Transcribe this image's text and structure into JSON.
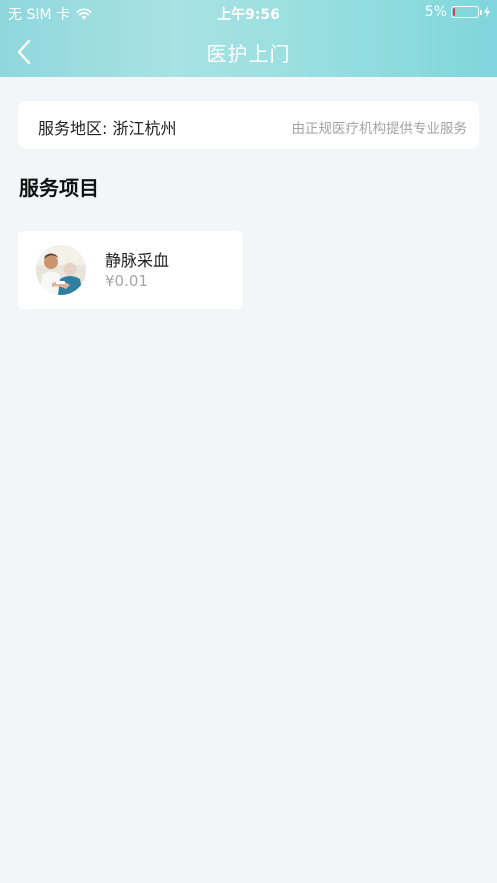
{
  "status_bar": {
    "carrier": "无 SIM 卡",
    "time": "上午9:56",
    "battery": "5%",
    "battery_level": 0.05,
    "icons": [
      "wifi-icon",
      "battery-icon",
      "charging-icon"
    ]
  },
  "nav": {
    "title": "医护上门",
    "back_icon": "chevron-left-icon"
  },
  "region": {
    "label": "服务地区: 浙江杭州",
    "note": "由正规医疗机构提供专业服务"
  },
  "section": {
    "title": "服务项目"
  },
  "services": [
    {
      "name": "静脉采血",
      "price": "¥0.01"
    }
  ],
  "colors": {
    "header_gradient_start": "#8fd7dc",
    "header_gradient_end": "#7fd6dc",
    "background": "#f4f5f9",
    "card": "#ffffff",
    "muted_text": "#a3a3a3",
    "battery_low": "#e53935"
  }
}
